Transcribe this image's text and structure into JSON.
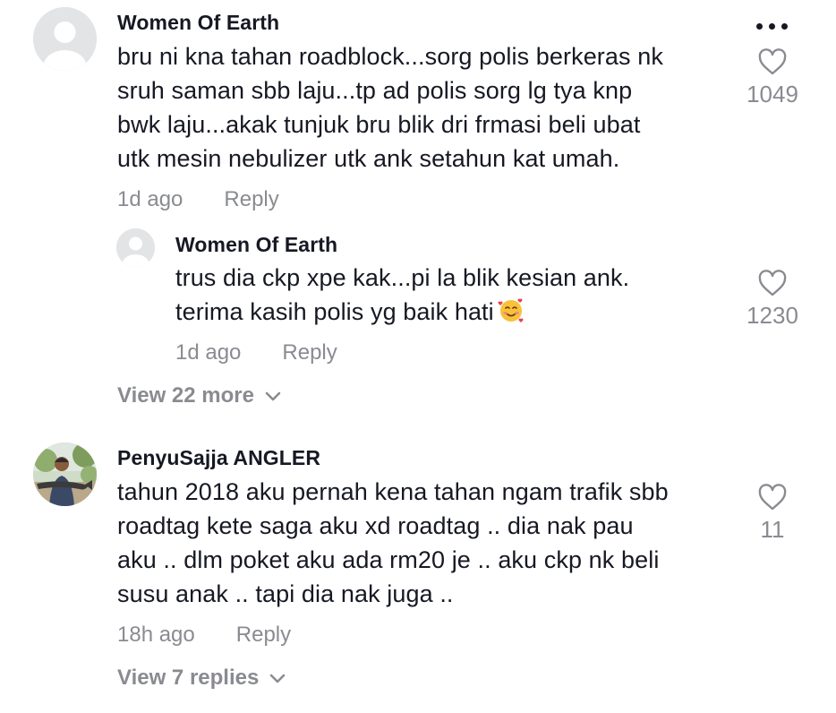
{
  "comments": [
    {
      "username": "Women Of Earth",
      "lines": [
        "bru ni kna tahan roadblock...sorg polis berkeras nk",
        "sruh saman sbb laju...tp ad polis sorg lg tya knp",
        "bwk laju...akak tunjuk bru blik dri frmasi beli ubat",
        "utk mesin nebulizer utk ank setahun kat umah."
      ],
      "time": "1d ago",
      "reply_label": "Reply",
      "likes": "1049",
      "avatar_icon": "default-avatar-icon",
      "more_icon": "more-options-icon",
      "replies": [
        {
          "username": "Women Of Earth",
          "lines": [
            "trus dia ckp xpe kak...pi la blik kesian ank.",
            "terima kasih polis yg baik hati"
          ],
          "emoji": "smiling-face-with-hearts-emoji",
          "time": "1d ago",
          "reply_label": "Reply",
          "likes": "1230"
        }
      ],
      "view_more": "View 22 more"
    },
    {
      "username": "PenyuSajja ANGLER",
      "lines": [
        "tahun 2018 aku pernah kena tahan ngam trafik sbb",
        "roadtag kete saga aku xd roadtag .. dia nak pau",
        "aku .. dlm poket aku ada rm20 je .. aku ckp nk beli",
        "susu anak .. tapi dia nak juga .."
      ],
      "time": "18h ago",
      "reply_label": "Reply",
      "likes": "11",
      "avatar_icon": "profile-photo-angler",
      "view_more": "View 7 replies"
    }
  ],
  "colors": {
    "text": "#161823",
    "muted": "#8a8b91",
    "avatar_bg": "#dfe1e4"
  }
}
